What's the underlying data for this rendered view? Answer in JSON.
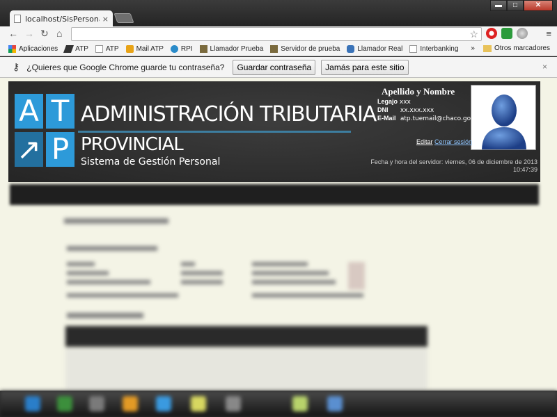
{
  "browser": {
    "tab_title": "localhost/SisPersonal/Apl",
    "tab_close": "×",
    "window_min": "▬",
    "window_max": "□",
    "window_close": "✕",
    "nav": {
      "back": "←",
      "forward": "→",
      "reload": "↻",
      "home": "⌂"
    },
    "bookmark_star": "☆",
    "menu": "≡",
    "bookmarks": [
      {
        "label": "Aplicaciones",
        "icon": "apps-grid-icon",
        "color": "#e8453c"
      },
      {
        "label": "ATP",
        "icon": "atp-icon",
        "color": "#333333"
      },
      {
        "label": "ATP",
        "icon": "page-icon",
        "color": "#999999"
      },
      {
        "label": "Mail ATP",
        "icon": "mail-icon",
        "color": "#e8a316"
      },
      {
        "label": "RPI",
        "icon": "rpi-icon",
        "color": "#2a8bc9"
      },
      {
        "label": "Llamador Prueba",
        "icon": "image-icon",
        "color": "#7a6a3d"
      },
      {
        "label": "Servidor de prueba",
        "icon": "image-icon",
        "color": "#7a6a3d"
      },
      {
        "label": "Llamador Real",
        "icon": "puzzle-icon",
        "color": "#3a73b8"
      },
      {
        "label": "Interbanking",
        "icon": "page-icon",
        "color": "#999999"
      }
    ],
    "bookmarks_more": "»",
    "other_bookmarks": "Otros marcadores"
  },
  "infobar": {
    "question": "¿Quieres que Google Chrome guarde tu contraseña?",
    "save_button": "Guardar contraseña",
    "never_button": "Jamás para este sitio",
    "close": "×"
  },
  "header": {
    "logo_letters": [
      "A",
      "T",
      "↗",
      "P"
    ],
    "title_line1": "ADMINISTRACIÓN TRIBUTARIA",
    "title_line2": "PROVINCIAL",
    "subtitle": "Sistema de Gestión Personal",
    "user_name": "Apellido y Nombre",
    "legajo_label": "Legajo",
    "legajo_value": "xxx",
    "dni_label": "DNI",
    "dni_value": "xx.xxx.xxx",
    "email_label": "E-Mail",
    "email_value": "atp.tuemail@chaco.gov.ar",
    "edit_link": "Editar",
    "logout_link": "Cerrar sesión",
    "server_time_label": "Fecha y hora del servidor: viernes, 06 de diciembre de 2013",
    "server_time": "10:47:39"
  },
  "colors": {
    "logo_blue": "#2d9ad9",
    "logo_dark_blue": "#23709f",
    "header_bg": "#2e2e2e",
    "page_bg": "#f4f4e6"
  }
}
